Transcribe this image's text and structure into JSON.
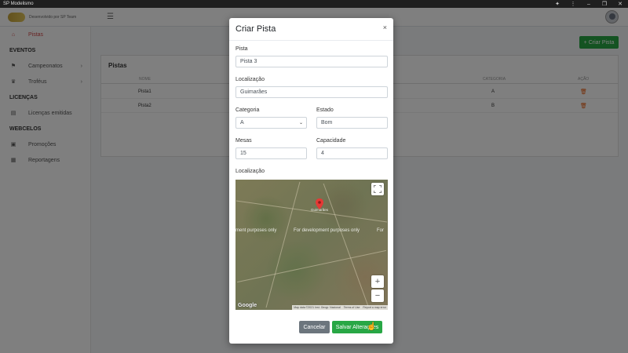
{
  "window": {
    "title": "SP Modelismo"
  },
  "navbar": {
    "brand_text": "Desenvolvido por SP Team"
  },
  "sidebar": {
    "items": [
      {
        "label": "Pistas",
        "icon": "home-icon",
        "active": true
      },
      {
        "header": "EVENTOS"
      },
      {
        "label": "Campeonatos",
        "icon": "flag-icon",
        "expandable": true
      },
      {
        "label": "Troféus",
        "icon": "trophy-icon",
        "expandable": true
      },
      {
        "header": "LICENÇAS"
      },
      {
        "label": "Licenças emitidas",
        "icon": "id-card-icon"
      },
      {
        "header": "WEBCELOS"
      },
      {
        "label": "Promoções",
        "icon": "tickets-icon"
      },
      {
        "label": "Reportagens",
        "icon": "newspaper-icon"
      }
    ]
  },
  "content": {
    "create_button": "Criar Pista",
    "card_title": "Pistas",
    "table": {
      "headers": [
        "NOME",
        "CATEGORIA",
        "AÇÃO"
      ],
      "rows": [
        {
          "nome": "Pista1",
          "categoria": "A"
        },
        {
          "nome": "Pista2",
          "categoria": "B"
        }
      ]
    }
  },
  "modal": {
    "title": "Criar Pista",
    "close": "×",
    "fields": {
      "pista": {
        "label": "Pista",
        "value": "Pista 3"
      },
      "localizacao": {
        "label": "Localização",
        "value": "Guimarães"
      },
      "categoria": {
        "label": "Categoria",
        "value": "A"
      },
      "estado": {
        "label": "Estado",
        "value": "Bom"
      },
      "mesas": {
        "label": "Mesas",
        "value": "15"
      },
      "capacidade": {
        "label": "Capacidade",
        "value": "4"
      }
    },
    "map": {
      "label": "Localização",
      "watermark_left": "ment purposes only",
      "watermark_center": "For development purposes only",
      "watermark_right": "For",
      "place_label": "Guimarães",
      "zoom_in": "+",
      "zoom_out": "−",
      "brand": "Google",
      "attribution": [
        "Map data ©2021 Inst. Geogr. Nacional",
        "Terms of Use",
        "Report a map error"
      ]
    },
    "buttons": {
      "cancel": "Cancelar",
      "save": "Salvar Alterações"
    }
  },
  "colors": {
    "primary_green": "#28a745",
    "secondary_gray": "#6c757d",
    "active_red": "#d04545",
    "trash_orange": "#e8590c"
  }
}
